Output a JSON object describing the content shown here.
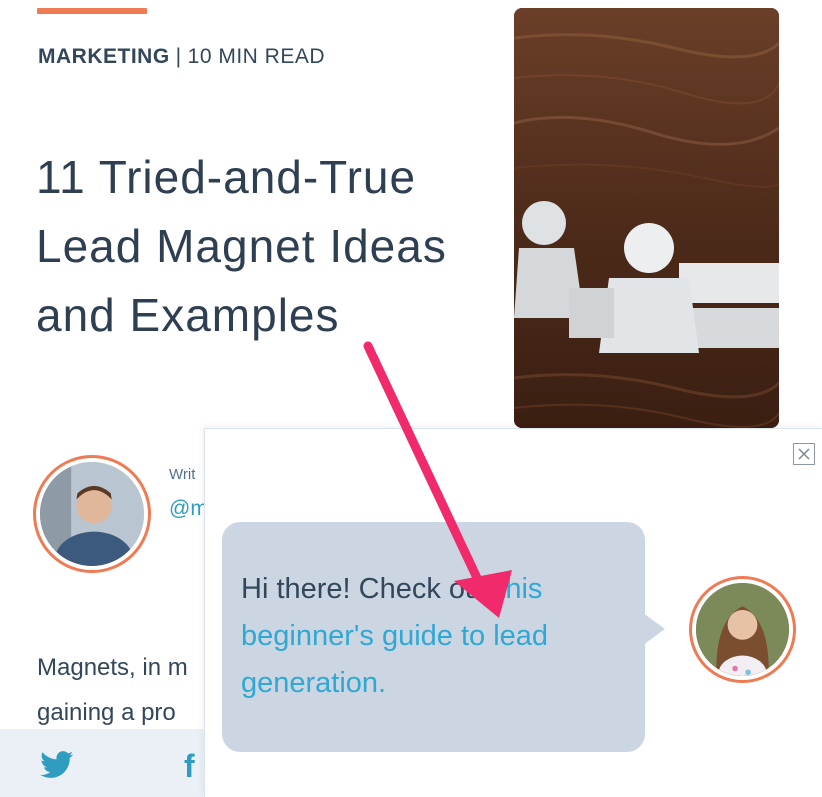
{
  "article": {
    "category": "MARKETING",
    "separator": "|",
    "read_time": "10 MIN READ",
    "title": "11 Tried-and-True Lead Magnet Ideas and Examples",
    "author": {
      "written_label": "Writ",
      "handle": "@m"
    },
    "intro_line_1": "Magnets, in m",
    "intro_line_2": "gaining a pro"
  },
  "share": {
    "twitter_icon": "twitter-icon",
    "facebook_icon": "facebook-icon",
    "facebook_glyph": "f"
  },
  "chat": {
    "message_plain": "Hi there! Check out ",
    "message_link": "this beginner's guide to lead generation.",
    "close_icon": "close-icon"
  },
  "colors": {
    "accent": "#ef7b55",
    "link": "#2fa8d4",
    "text": "#33475b",
    "bubble": "#cbd6e2",
    "arrow": "#f02a6b"
  }
}
